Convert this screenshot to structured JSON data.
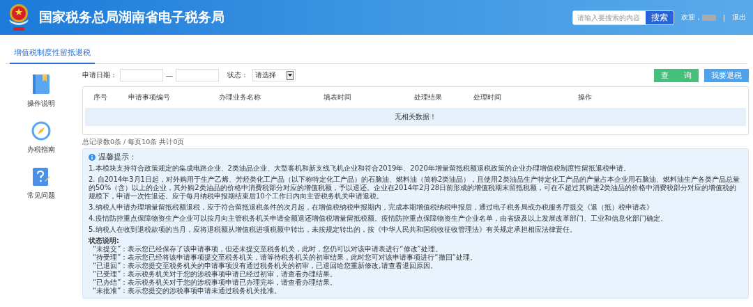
{
  "header": {
    "title": "国家税务总局湖南省电子税务局",
    "search": {
      "placeholder": "请输入要搜索的内容",
      "button": "搜索"
    },
    "welcome": "欢迎，",
    "separator": "|",
    "logout": "退出"
  },
  "tabs": [
    {
      "label": "增值税制度性留抵退税",
      "selected": true
    }
  ],
  "sidebar": {
    "items": [
      {
        "kind": "book",
        "label": "操作说明"
      },
      {
        "kind": "compass",
        "label": "办税指南"
      },
      {
        "kind": "question",
        "label": "常见问题"
      }
    ]
  },
  "filters": {
    "date_label": "申请日期：",
    "date_separator": "—",
    "status_label": "状态：",
    "status_value": "请选择"
  },
  "buttons": [
    {
      "kind": "query",
      "label": "查　　询"
    },
    {
      "kind": "refund",
      "label": "我要退税"
    }
  ],
  "table": {
    "columns": [
      "序号",
      "申请事项编号",
      "办理业务名称",
      "填表时间",
      "处理结果",
      "处理时间",
      "操作"
    ],
    "empty_message": "无相关数据！"
  },
  "pagination": "总记录数0条 / 每页10条 共计0页",
  "notice": {
    "title": "温馨提示：",
    "paragraphs": [
      "1.本模块支持符合政策规定的集成电路企业、2类油品企业、大型客机和新支线飞机企业和符合2019年、2020年增量留抵税额退税政策的企业办理增值税制度性留抵退税申请。",
      "2. 自2014年3月1日起，对外购用于生产乙烯、芳烃类化工产品（以下称特定化工产品）的石脑油、燃料油（简称2类油品），且使用2类油品生产特定化工产品的产量占本企业用石脑油、燃料油生产各类产品总量的50%（含）以上的企业，其外购2类油品的价格中消费税部分对应的增值税额，予以退还。企业在2014年2月28日前形成的增值税期末留抵税额，可在不超过其购进2类油品的价格中消费税部分对应的增值税的规模下，申请一次性退还。应于每月纳税申报期结束后10个工作日内向主管税务机关申请退税。",
      "3.纳税人申请办理增量留抵税额退税，应于符合留抵退税条件的次月起，在增值税纳税申报期内，完成本期增值税纳税申报后，通过电子税务局或办税服务厅提交《退（抵）税申请表》",
      "4.疫情防控重点保障物资生产企业可以按月向主管税务机关申请全额退还增值税增量留抵税额。疫情防控重点保障物资生产企业名单，由省级及以上发展改革部门、工业和信息化部门确定。",
      "5.纳税人在收到退税款项的当月，应将退税额从增值税进项税额中转出，未按规定转出的，按《中华人民共和国税收征收管理法》有关规定承担相应法律责任。"
    ],
    "status_title": "状态说明:",
    "status_lines": [
      "“未提交”：表示您已经保存了该申请事项，但还未提交至税务机关，此时，您仍可以对该申请表进行“修改”处理。",
      "“待受理”：表示您已经将该申请事项提交至税务机关，请等待税务机关的初审结果，此时您可对该申请事项进行“撤回”处理。",
      "“已退回”：表示您提交至税务机关的申请事项没有通过税务机关的初审，已退回给您重新修改,请查看退回原因。",
      "“已受理”：表示税务机关对于您的涉税事项申请已经过初审，请查看办理结果。",
      "“已办结”：表示税务机关对于您的涉税事项申请已办理完毕，请查看办理结果。",
      "“未批准”：表示您提交的涉税事项申请未通过税务机关批准。"
    ]
  }
}
